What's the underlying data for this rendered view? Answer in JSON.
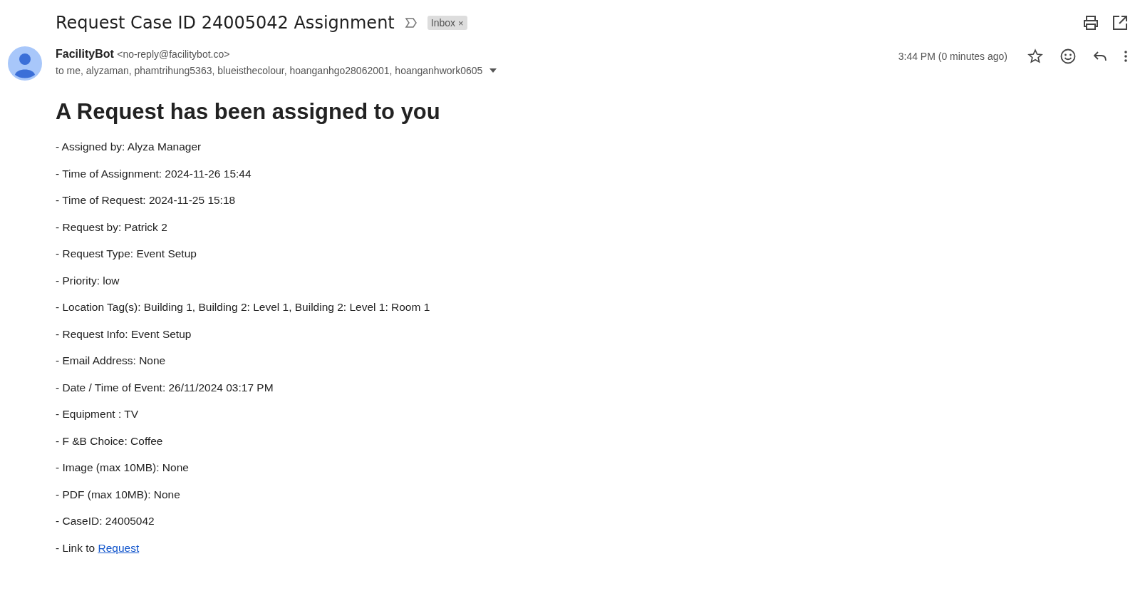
{
  "subject": "Request Case ID 24005042 Assignment",
  "label": {
    "text": "Inbox",
    "remove": "×"
  },
  "sender": {
    "name": "FacilityBot",
    "email": "<no-reply@facilitybot.co>",
    "recipients": "to me, alyzaman, phamtrihung5363, blueisthecolour, hoanganhgo28062001, hoanganhwork0605"
  },
  "time": "3:44 PM (0 minutes ago)",
  "starred": false,
  "heading": "A Request has been assigned to you",
  "lines": [
    "- Assigned by: Alyza Manager",
    "- Time of Assignment: 2024-11-26 15:44",
    "- Time of Request: 2024-11-25 15:18",
    "- Request by: Patrick 2",
    "- Request Type: Event Setup",
    "- Priority: low",
    "- Location Tag(s): Building 1, Building 2: Level 1, Building 2: Level 1: Room 1",
    "- Request Info: Event Setup",
    "- Email Address: None",
    "- Date / Time of Event: 26/11/2024 03:17 PM",
    "- Equipment : TV",
    "- F &B Choice: Coffee",
    "- Image (max 10MB): None",
    "- PDF (max 10MB): None",
    "- CaseID: 24005042"
  ],
  "link_line": {
    "text": "- Link to",
    "link": "Request"
  }
}
